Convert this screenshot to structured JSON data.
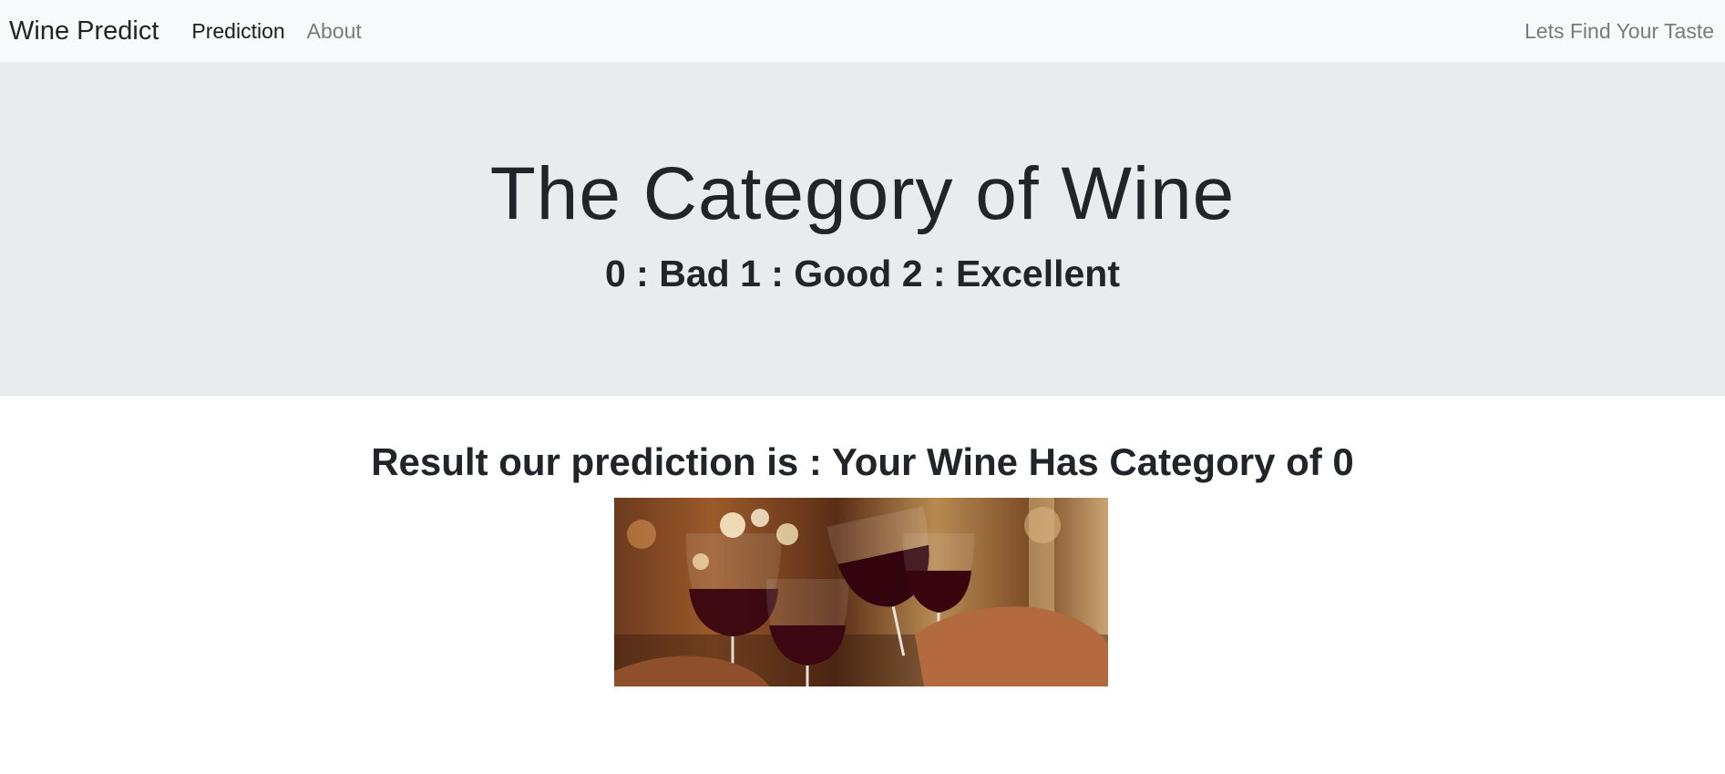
{
  "navbar": {
    "brand": "Wine Predict",
    "links": [
      {
        "label": "Prediction",
        "active": true
      },
      {
        "label": "About",
        "active": false
      }
    ],
    "right_text": "Lets Find Your Taste"
  },
  "jumbotron": {
    "title": "The Category of Wine",
    "subtitle": "0 : Bad 1 : Good 2 : Excellent"
  },
  "result": {
    "text": "Result our prediction is : Your Wine Has Category of 0"
  },
  "colors": {
    "navbar_bg": "#f8f9fa",
    "jumbotron_bg": "#e9ecef",
    "text": "#212529",
    "muted": "#7a7a7a"
  }
}
